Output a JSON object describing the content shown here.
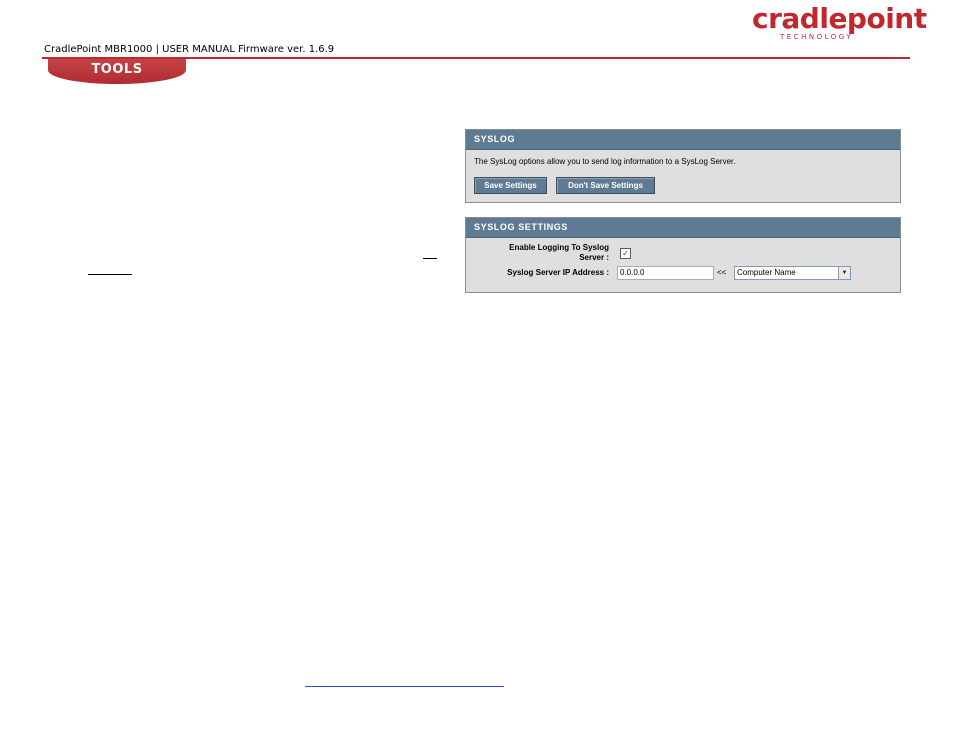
{
  "brand": {
    "logo_text": "cradlepoint",
    "logo_sub": "TECHNOLOGY",
    "brand_color": "#c0282d"
  },
  "header": {
    "doc_line": "CradlePoint MBR1000 | USER MANUAL Firmware ver. 1.6.9",
    "section_tab": "TOOLS"
  },
  "syslog_panel": {
    "title": "SYSLOG",
    "description": "The SysLog options allow you to send log information to a SysLog Server.",
    "buttons": {
      "save": "Save Settings",
      "dont_save": "Don't Save Settings"
    }
  },
  "syslog_settings_panel": {
    "title": "SYSLOG SETTINGS",
    "enable_label_line1": "Enable Logging To Syslog",
    "enable_label_line2": "Server :",
    "enable_checked": true,
    "check_glyph": "✓",
    "ip_label": "Syslog Server IP Address :",
    "ip_value": "0.0.0.0",
    "arrows": "<<",
    "computer_select_value": "Computer Name",
    "select_arrow_glyph": "▼"
  },
  "colors": {
    "panel_title_bg": "#5f7a93",
    "panel_bg": "#dfdfdf",
    "button_bg": "#5f7a93"
  }
}
